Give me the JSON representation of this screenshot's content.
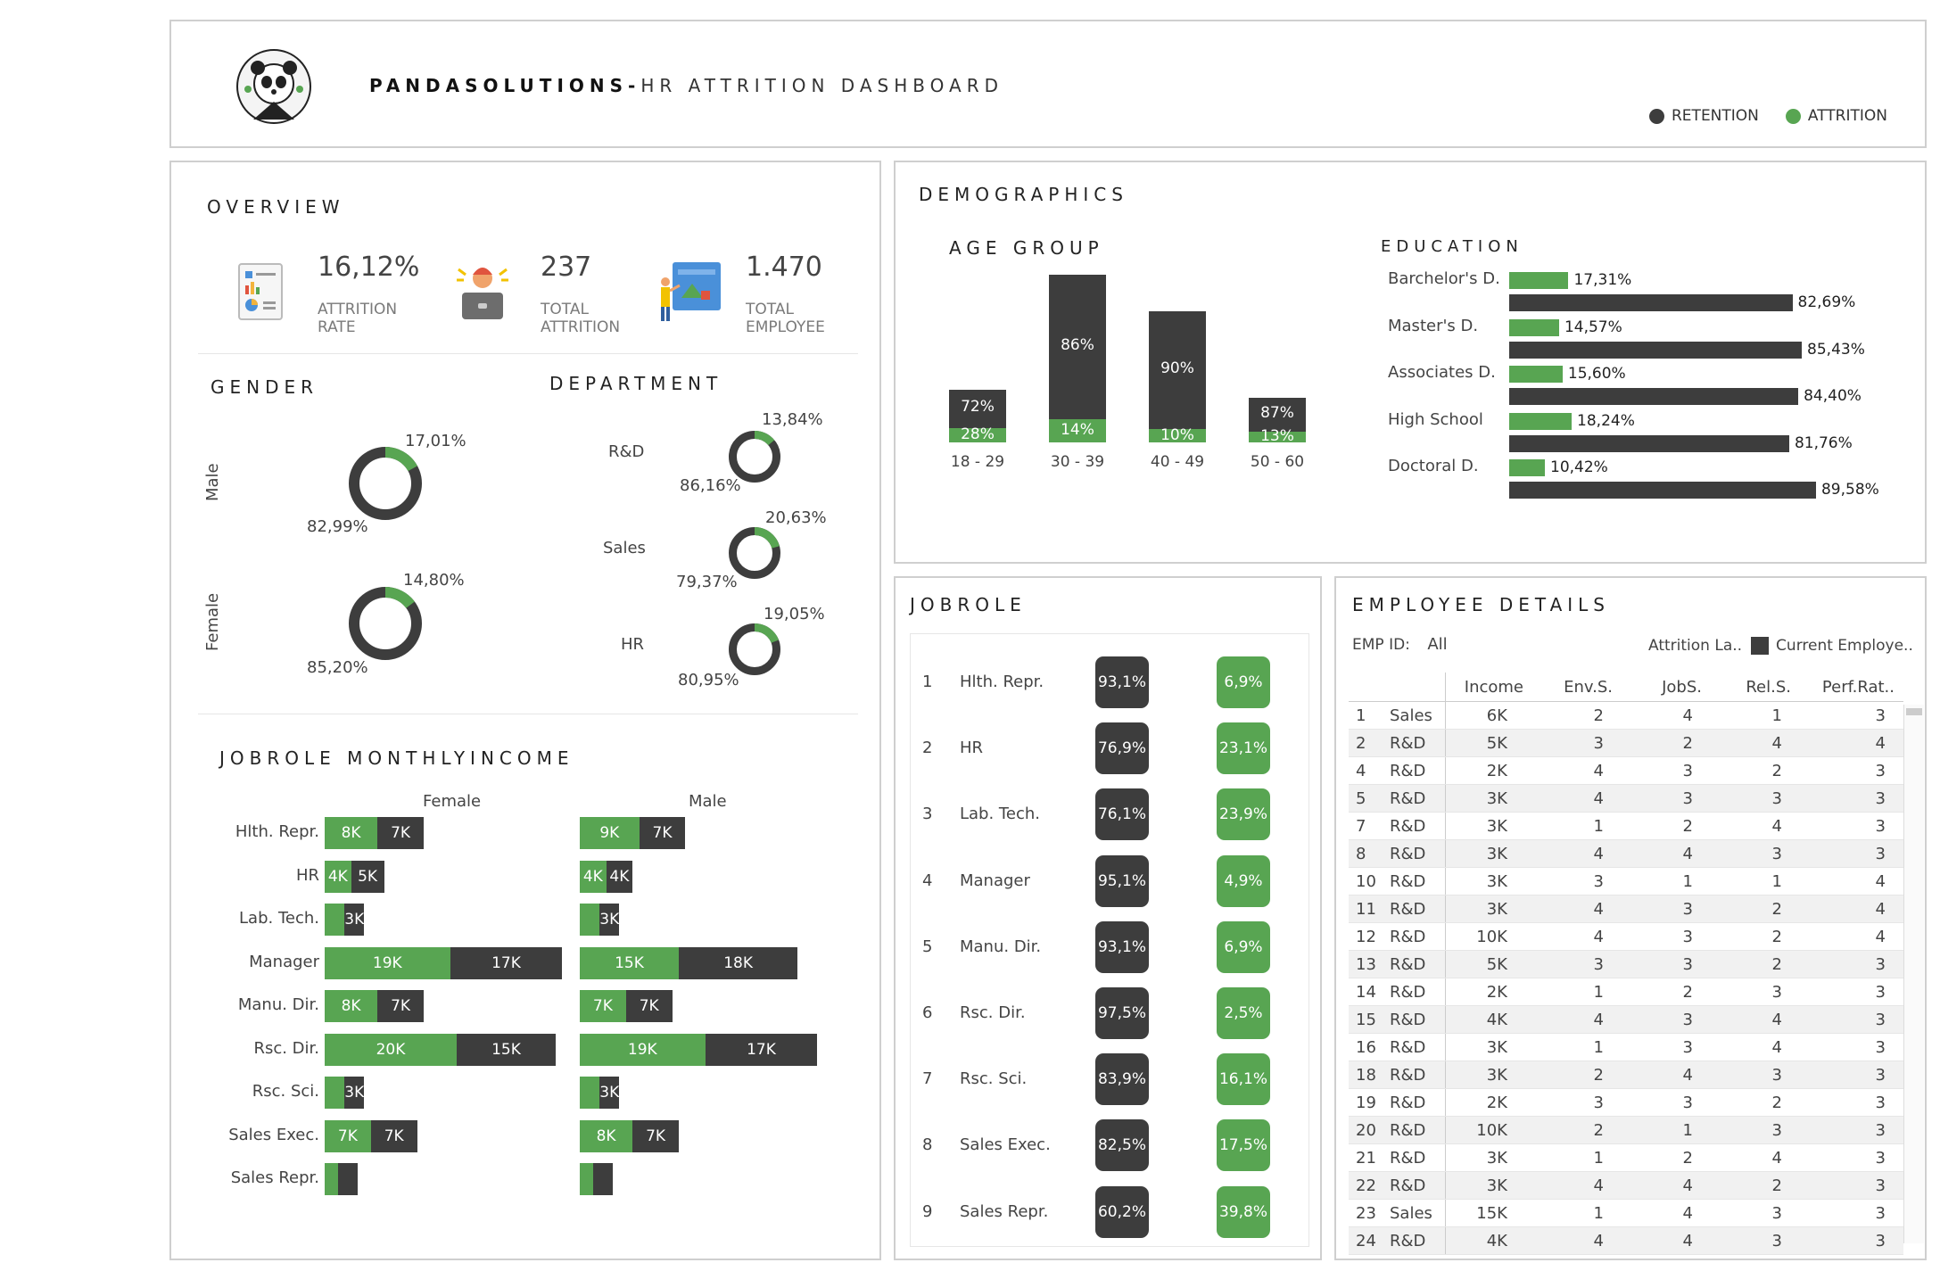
{
  "header": {
    "brand": "PANDASOLUTIONS-",
    "title": "HR ATTRITION DASHBOARD",
    "legend": [
      {
        "label": "RETENTION",
        "color": "#3d3d3d"
      },
      {
        "label": "ATTRITION",
        "color": "#58a552"
      }
    ]
  },
  "overview": {
    "title": "OVERVIEW",
    "kpis": [
      {
        "value": "16,12%",
        "label1": "ATTRITION",
        "label2": "RATE",
        "icon": "report-icon"
      },
      {
        "value": "237",
        "label1": "TOTAL",
        "label2": "ATTRITION",
        "icon": "stressed-worker-icon"
      },
      {
        "value": "1.470",
        "label1": "TOTAL",
        "label2": "EMPLOYEE",
        "icon": "presentation-icon"
      }
    ]
  },
  "gender": {
    "title": "GENDER",
    "items": [
      {
        "label": "Male",
        "attrition": "17,01%",
        "retention": "82,99%",
        "attrition_fraction": 0.1701
      },
      {
        "label": "Female",
        "attrition": "14,80%",
        "retention": "85,20%",
        "attrition_fraction": 0.148
      }
    ]
  },
  "department": {
    "title": "DEPARTMENT",
    "items": [
      {
        "label": "R&D",
        "attrition": "13,84%",
        "retention": "86,16%",
        "attrition_fraction": 0.1384
      },
      {
        "label": "Sales",
        "attrition": "20,63%",
        "retention": "79,37%",
        "attrition_fraction": 0.2063
      },
      {
        "label": "HR",
        "attrition": "19,05%",
        "retention": "80,95%",
        "attrition_fraction": 0.1905
      }
    ]
  },
  "demographics": {
    "title": "DEMOGRAPHICS",
    "age_title": "AGE GROUP",
    "education_title": "EDUCATION"
  },
  "jobrole_income": {
    "title": "JOBROLE MONTHLYINCOME",
    "female_label": "Female",
    "male_label": "Male"
  },
  "jobrole": {
    "title": "JOBROLE",
    "rows": [
      {
        "n": "1",
        "role": "Hlth. Repr.",
        "retention": "93,1%",
        "attrition": "6,9%"
      },
      {
        "n": "2",
        "role": "HR",
        "retention": "76,9%",
        "attrition": "23,1%"
      },
      {
        "n": "3",
        "role": "Lab. Tech.",
        "retention": "76,1%",
        "attrition": "23,9%"
      },
      {
        "n": "4",
        "role": "Manager",
        "retention": "95,1%",
        "attrition": "4,9%"
      },
      {
        "n": "5",
        "role": "Manu. Dir.",
        "retention": "93,1%",
        "attrition": "6,9%"
      },
      {
        "n": "6",
        "role": "Rsc. Dir.",
        "retention": "97,5%",
        "attrition": "2,5%"
      },
      {
        "n": "7",
        "role": "Rsc. Sci.",
        "retention": "83,9%",
        "attrition": "16,1%"
      },
      {
        "n": "8",
        "role": "Sales Exec.",
        "retention": "82,5%",
        "attrition": "17,5%"
      },
      {
        "n": "9",
        "role": "Sales Repr.",
        "retention": "60,2%",
        "attrition": "39,8%"
      }
    ]
  },
  "employee_details": {
    "title": "EMPLOYEE DETAILS",
    "emp_id_label": "EMP ID:",
    "emp_id_value": "All",
    "legend_attrition": "Attrition La..",
    "legend_current": "Current Employe..",
    "columns": [
      "Income",
      "Env.S.",
      "JobS.",
      "Rel.S.",
      "Perf.Rat.."
    ],
    "rows": [
      [
        "1",
        "Sales",
        "6K",
        "2",
        "4",
        "1",
        "3"
      ],
      [
        "2",
        "R&D",
        "5K",
        "3",
        "2",
        "4",
        "4"
      ],
      [
        "4",
        "R&D",
        "2K",
        "4",
        "3",
        "2",
        "3"
      ],
      [
        "5",
        "R&D",
        "3K",
        "4",
        "3",
        "3",
        "3"
      ],
      [
        "7",
        "R&D",
        "3K",
        "1",
        "2",
        "4",
        "3"
      ],
      [
        "8",
        "R&D",
        "3K",
        "4",
        "4",
        "3",
        "3"
      ],
      [
        "10",
        "R&D",
        "3K",
        "3",
        "1",
        "1",
        "4"
      ],
      [
        "11",
        "R&D",
        "3K",
        "4",
        "3",
        "2",
        "4"
      ],
      [
        "12",
        "R&D",
        "10K",
        "4",
        "3",
        "2",
        "4"
      ],
      [
        "13",
        "R&D",
        "5K",
        "3",
        "3",
        "2",
        "3"
      ],
      [
        "14",
        "R&D",
        "2K",
        "1",
        "2",
        "3",
        "3"
      ],
      [
        "15",
        "R&D",
        "4K",
        "4",
        "3",
        "4",
        "3"
      ],
      [
        "16",
        "R&D",
        "3K",
        "1",
        "3",
        "4",
        "3"
      ],
      [
        "18",
        "R&D",
        "3K",
        "2",
        "4",
        "3",
        "3"
      ],
      [
        "19",
        "R&D",
        "2K",
        "3",
        "3",
        "2",
        "3"
      ],
      [
        "20",
        "R&D",
        "10K",
        "2",
        "1",
        "3",
        "3"
      ],
      [
        "21",
        "R&D",
        "3K",
        "1",
        "2",
        "4",
        "3"
      ],
      [
        "22",
        "R&D",
        "3K",
        "4",
        "4",
        "2",
        "3"
      ],
      [
        "23",
        "Sales",
        "15K",
        "1",
        "4",
        "3",
        "3"
      ],
      [
        "24",
        "R&D",
        "4K",
        "4",
        "4",
        "3",
        "3"
      ]
    ]
  },
  "chart_data": [
    {
      "type": "bar",
      "title": "AGE GROUP",
      "stacked": true,
      "categories": [
        "18 - 29",
        "30 - 39",
        "40 - 49",
        "50 - 60"
      ],
      "category_totals": [
        194,
        622,
        487,
        167
      ],
      "series": [
        {
          "name": "ATTRITION",
          "values": [
            28,
            14,
            10,
            13
          ],
          "labels": [
            "28%",
            "14%",
            "10%",
            "13%"
          ],
          "color": "#58a552"
        },
        {
          "name": "RETENTION",
          "values": [
            72,
            86,
            90,
            87
          ],
          "labels": [
            "72%",
            "86%",
            "90%",
            "87%"
          ],
          "color": "#3d3d3d"
        }
      ]
    },
    {
      "type": "bar",
      "title": "EDUCATION",
      "orientation": "horizontal",
      "categories": [
        "Barchelor's D.",
        "Master's D.",
        "Associates D.",
        "High School",
        "Doctoral D."
      ],
      "series": [
        {
          "name": "ATTRITION",
          "values": [
            17.31,
            14.57,
            15.6,
            18.24,
            10.42
          ],
          "labels": [
            "17,31%",
            "14,57%",
            "15,60%",
            "18,24%",
            "10,42%"
          ],
          "color": "#58a552"
        },
        {
          "name": "RETENTION",
          "values": [
            82.69,
            85.43,
            84.4,
            81.76,
            89.58
          ],
          "labels": [
            "82,69%",
            "85,43%",
            "84,40%",
            "81,76%",
            "89,58%"
          ],
          "color": "#3d3d3d"
        }
      ]
    },
    {
      "type": "bar",
      "title": "JOBROLE MONTHLYINCOME",
      "orientation": "horizontal",
      "stacked": true,
      "categories": [
        "Hlth. Repr.",
        "HR",
        "Lab. Tech.",
        "Manager",
        "Manu. Dir.",
        "Rsc. Dir.",
        "Rsc. Sci.",
        "Sales Exec.",
        "Sales Repr."
      ],
      "panels": [
        {
          "name": "Female",
          "series": [
            {
              "name": "ATTRITION",
              "values": [
                8,
                4,
                3,
                19,
                8,
                20,
                3,
                7,
                2
              ],
              "labels": [
                "8K",
                "4K",
                "",
                "19K",
                "8K",
                "20K",
                "",
                "7K",
                ""
              ],
              "color": "#58a552"
            },
            {
              "name": "RETENTION",
              "values": [
                7,
                5,
                3,
                17,
                7,
                15,
                3,
                7,
                3
              ],
              "labels": [
                "7K",
                "5K",
                "3K",
                "17K",
                "7K",
                "15K",
                "3K",
                "7K",
                ""
              ],
              "color": "#3d3d3d"
            }
          ]
        },
        {
          "name": "Male",
          "series": [
            {
              "name": "ATTRITION",
              "values": [
                9,
                4,
                3,
                15,
                7,
                19,
                3,
                8,
                2
              ],
              "labels": [
                "9K",
                "4K",
                "",
                "15K",
                "7K",
                "19K",
                "",
                "8K",
                ""
              ],
              "color": "#58a552"
            },
            {
              "name": "RETENTION",
              "values": [
                7,
                4,
                3,
                18,
                7,
                17,
                3,
                7,
                3
              ],
              "labels": [
                "7K",
                "4K",
                "3K",
                "18K",
                "7K",
                "17K",
                "3K",
                "7K",
                ""
              ],
              "color": "#3d3d3d"
            }
          ]
        }
      ]
    }
  ]
}
